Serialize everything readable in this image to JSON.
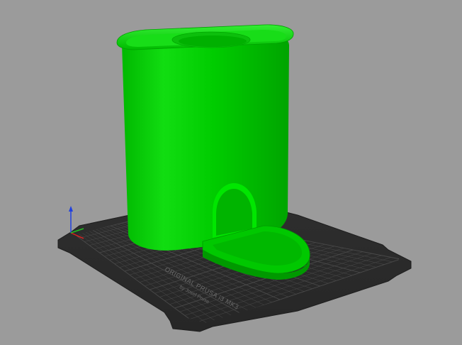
{
  "viewport": {
    "background": "#9b9b9b"
  },
  "bed": {
    "label_line1": "ORIGINAL PRUSA i3 MK3",
    "label_line2": "by Josef Prusa",
    "plate_color": "#2a2a2a",
    "grid_color": "#4a4a4a"
  },
  "axes": {
    "x_color": "#e02020",
    "y_color": "#20c020",
    "z_color": "#2040e0"
  },
  "model": {
    "color": "#00cc00",
    "highlight_color": "#22ee22",
    "shadow_color": "#009900"
  }
}
